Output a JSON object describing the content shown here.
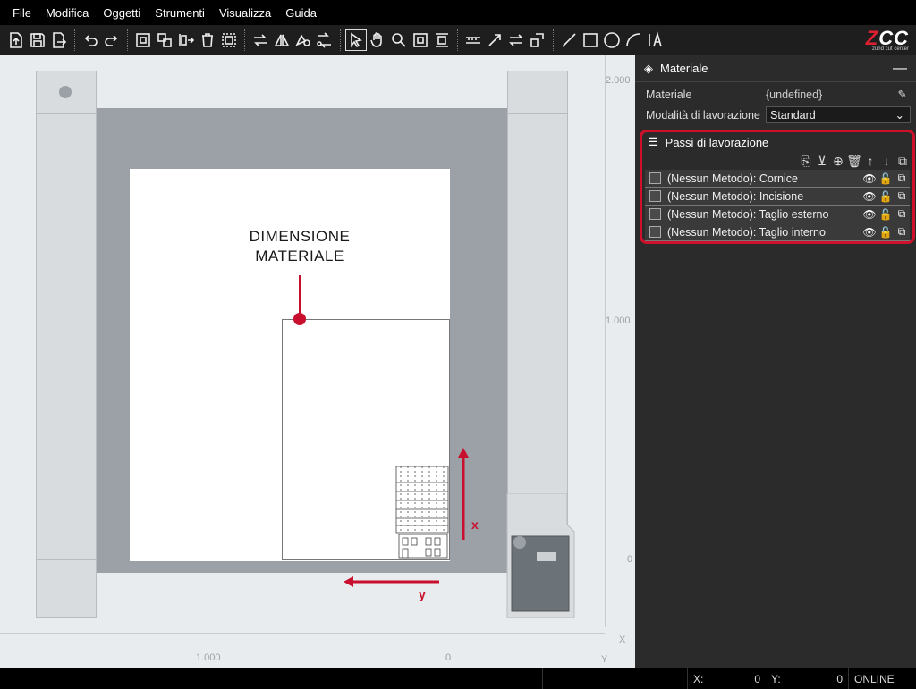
{
  "menu": [
    "File",
    "Modifica",
    "Oggetti",
    "Strumenti",
    "Visualizza",
    "Guida"
  ],
  "logo": {
    "brand_a": "Z",
    "brand_b": "CC",
    "tagline": "zünd cut center"
  },
  "toolbar_icons": [
    "open-icon",
    "save-icon",
    "export-icon",
    "undo-icon",
    "redo-icon",
    "group-icon",
    "ungroup-icon",
    "align-icon",
    "delete-icon",
    "select-all-icon",
    "flip-icon",
    "mirror-icon",
    "rotate-icon",
    "transform-icon",
    "pointer-icon",
    "pan-icon",
    "zoom-icon",
    "fit-icon",
    "fit-width-icon",
    "measure-icon",
    "arrow-icon",
    "swap-icon",
    "text-path-icon",
    "line-icon",
    "rectangle-icon",
    "circle-icon",
    "arc-icon",
    "text-icon"
  ],
  "canvas": {
    "ruler_v": [
      "2.000",
      "1.000",
      "0"
    ],
    "ruler_h": [
      "1.000",
      "0"
    ],
    "axis_x": "X",
    "axis_y": "Y",
    "annotation": [
      "DIMENSIONE",
      "MATERIALE"
    ],
    "arrow_x": "x",
    "arrow_y": "y",
    "colors": {
      "accent": "#c8102e",
      "table": "#9ba1a6",
      "rail": "#d9dcdf"
    }
  },
  "panel": {
    "material_header": "Materiale",
    "material_label": "Materiale",
    "material_value": "{undefined}",
    "mode_label": "Modalità di lavorazione",
    "mode_value": "Standard",
    "steps_header": "Passi di lavorazione",
    "steps": [
      {
        "name": "(Nessun Metodo): Cornice"
      },
      {
        "name": "(Nessun Metodo): Incisione"
      },
      {
        "name": "(Nessun Metodo): Taglio esterno"
      },
      {
        "name": "(Nessun Metodo): Taglio interno"
      }
    ]
  },
  "status": {
    "x_label": "X:",
    "x_value": "0",
    "y_label": "Y:",
    "y_value": "0",
    "state": "ONLINE"
  }
}
